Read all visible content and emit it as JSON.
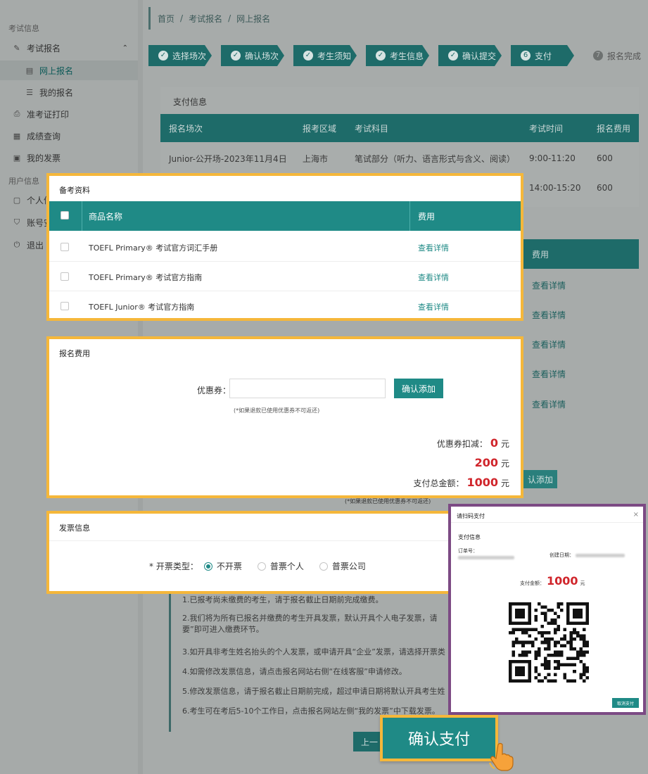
{
  "sidebar": {
    "group_exam": "考试信息",
    "items": [
      {
        "label": "考试报名",
        "icon": "edit-icon"
      },
      {
        "label": "网上报名",
        "icon": "document-icon"
      },
      {
        "label": "我的报名",
        "icon": "list-icon"
      },
      {
        "label": "准考证打印",
        "icon": "print-icon"
      },
      {
        "label": "成绩查询",
        "icon": "score-icon"
      },
      {
        "label": "我的发票",
        "icon": "invoice-icon"
      }
    ],
    "group_user": "用户信息",
    "user_items": [
      {
        "label": "个人信",
        "icon": "user-icon"
      },
      {
        "label": "账号安",
        "icon": "shield-icon"
      },
      {
        "label": "退出",
        "icon": "logout-icon"
      }
    ]
  },
  "breadcrumb": [
    "首页",
    "考试报名",
    "网上报名"
  ],
  "steps": [
    "选择场次",
    "确认场次",
    "考生须知",
    "考生信息",
    "确认提交",
    "支付",
    "报名完成"
  ],
  "payment_info": {
    "heading": "支付信息",
    "columns": [
      "报名场次",
      "报考区域",
      "考试科目",
      "考试时间",
      "报名费用"
    ],
    "rows": [
      [
        "Junior-公开场-2023年11月4日",
        "上海市",
        "笔试部分（听力、语言形式与含义、阅读）",
        "9:00-11:20",
        "600"
      ],
      [
        "",
        "",
        "",
        "14:00-15:20",
        "600"
      ]
    ]
  },
  "bg_goods": {
    "fee_header": "费用",
    "links": [
      "查看详情",
      "查看详情",
      "查看详情",
      "查看详情",
      "查看详情"
    ],
    "add_btn": "认添加",
    "note": "(*如果退款已使用优惠券不可返还)"
  },
  "materials": {
    "title": "备考资料",
    "col_name": "商品名称",
    "col_fee": "费用",
    "items": [
      {
        "name": "TOEFL Primary® 考试官方词汇手册",
        "link": "查看详情"
      },
      {
        "name": "TOEFL Primary® 考试官方指南",
        "link": "查看详情"
      },
      {
        "name": "TOEFL Junior® 考试官方指南",
        "link": "查看详情"
      }
    ]
  },
  "fee": {
    "title": "报名费用",
    "coupon_label": "优惠券：",
    "coupon_value": "",
    "coupon_btn": "确认添加",
    "coupon_note": "(*如果退款已使用优惠券不可返还)",
    "discount_label": "优惠券扣减：",
    "discount_value": "0",
    "materials_value": "200",
    "total_label": "支付总金额：",
    "total_value": "1000",
    "unit": "元"
  },
  "invoice": {
    "title": "发票信息",
    "type_label": "* 开票类型：",
    "options": [
      "不开票",
      "普票个人",
      "普票公司"
    ],
    "selected": "不开票"
  },
  "notes": [
    "1.已报考尚未缴费的考生，请于报名截止日期前完成缴费。",
    "2.我们将为所有已报名并缴费的考生开具发票，默认开具个人电子发票，请",
    "要”即可进入缴费环节。",
    "3.如开具非考生姓名抬头的个人发票，或申请开具“企业”发票，请选择开票类",
    "4.如需修改发票信息，请点击报名网站右侧“在线客服”申请修改。",
    "5.修改发票信息，请于报名截止日期前完成，超过申请日期将默认开具考生姓",
    "6.考生可在考后5-10个工作日，点击报名网站左侧“我的发票”中下载发票。"
  ],
  "prev_btn": "上一",
  "qr_modal": {
    "title": "请扫码支付",
    "close": "×",
    "section": "支付信息",
    "order_label": "订单号：",
    "created_label": "创建日期：",
    "amount_label": "支付金额：",
    "amount_value": "1000",
    "unit": "元",
    "cancel": "取消支付"
  },
  "confirm_pay": "确认支付",
  "colors": {
    "teal": "#1f8a86",
    "highlight": "#f5b73a",
    "modal_border": "#7c4a84",
    "price_red": "#d0252b"
  }
}
